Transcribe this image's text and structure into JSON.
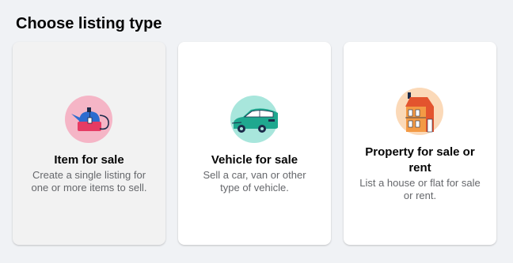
{
  "page": {
    "title": "Choose listing type"
  },
  "cards": [
    {
      "title": "Item for sale",
      "description": "Create a single listing for one or more items to sell.",
      "icon": "kettle-icon",
      "icon_bg": "#f5b5c6"
    },
    {
      "title": "Vehicle for sale",
      "description": "Sell a car, van or other type of vehicle.",
      "icon": "car-icon",
      "icon_bg": "#a8e6dc"
    },
    {
      "title": "Property for sale or rent",
      "description": "List a house or flat for sale or rent.",
      "icon": "house-icon",
      "icon_bg": "#fbd9b8"
    }
  ]
}
